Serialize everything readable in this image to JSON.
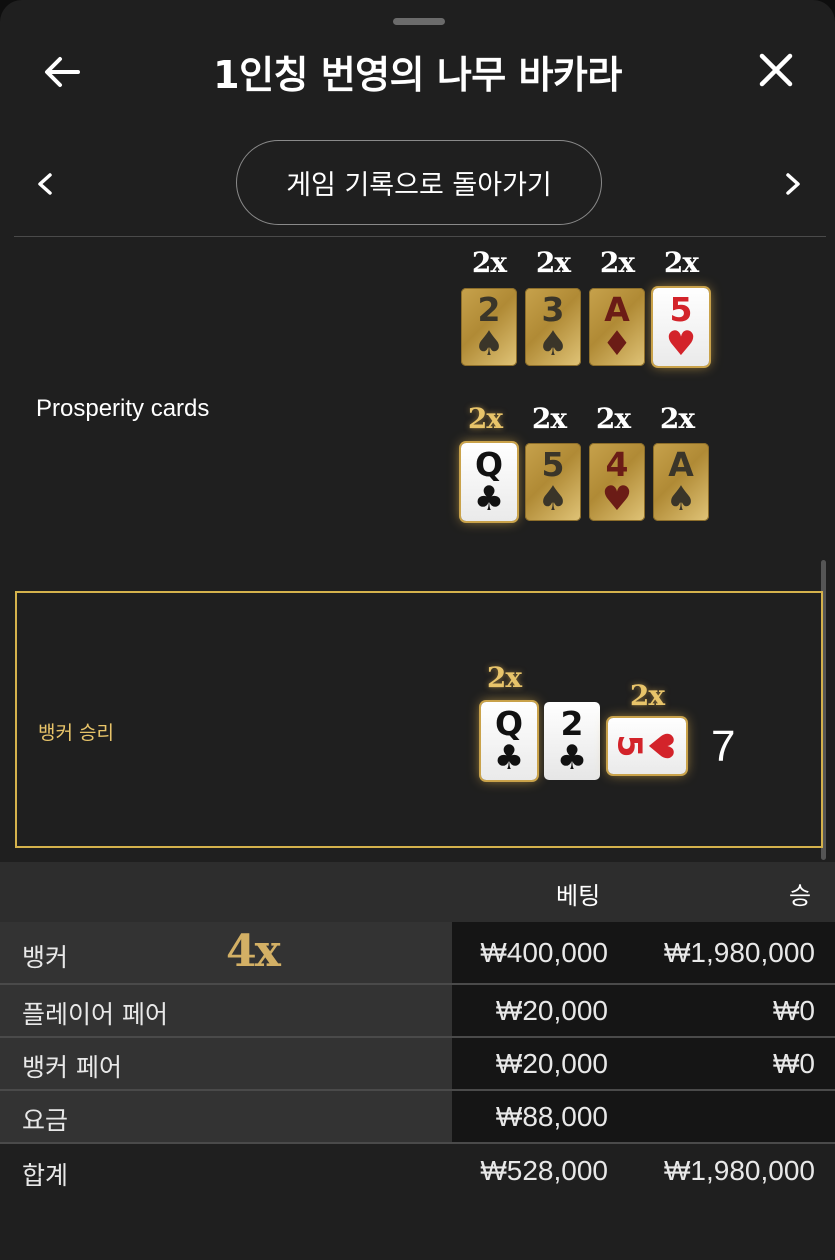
{
  "header": {
    "title": "1인칭 번영의 나무 바카라"
  },
  "nav": {
    "history_label": "게임 기록으로 돌아가기"
  },
  "prosperity": {
    "label": "Prosperity cards",
    "rows": [
      [
        {
          "mult": "2x",
          "rank": "2",
          "suit": "♠",
          "color": "black",
          "highlight": false
        },
        {
          "mult": "2x",
          "rank": "3",
          "suit": "♠",
          "color": "black",
          "highlight": false
        },
        {
          "mult": "2x",
          "rank": "A",
          "suit": "♦",
          "color": "red",
          "highlight": false
        },
        {
          "mult": "2x",
          "rank": "5",
          "suit": "♥",
          "color": "red",
          "highlight": true
        }
      ],
      [
        {
          "mult": "2x",
          "rank": "Q",
          "suit": "♣",
          "color": "black",
          "highlight": true
        },
        {
          "mult": "2x",
          "rank": "5",
          "suit": "♠",
          "color": "black",
          "highlight": false
        },
        {
          "mult": "2x",
          "rank": "4",
          "suit": "♥",
          "color": "red",
          "highlight": false
        },
        {
          "mult": "2x",
          "rank": "A",
          "suit": "♠",
          "color": "black",
          "highlight": false
        }
      ]
    ]
  },
  "result": {
    "label": "뱅커 승리",
    "cards": [
      {
        "mult": "2x",
        "rank": "Q",
        "suit": "♣",
        "color": "black"
      },
      {
        "mult": "",
        "rank": "2",
        "suit": "♣",
        "color": "black"
      },
      {
        "mult": "2x",
        "rank": "5",
        "suit": "♥",
        "color": "red"
      }
    ],
    "score": "7"
  },
  "table": {
    "headers": {
      "bet": "베팅",
      "win": "승"
    },
    "rows": [
      {
        "name": "뱅커",
        "multiplier": "4x",
        "bet": "₩400,000",
        "win": "₩1,980,000"
      },
      {
        "name": "플레이어 페어",
        "bet": "₩20,000",
        "win": "₩0"
      },
      {
        "name": "뱅커 페어",
        "bet": "₩20,000",
        "win": "₩0"
      },
      {
        "name": "요금",
        "bet": "₩88,000",
        "win": ""
      }
    ],
    "total": {
      "name": "합계",
      "bet": "₩528,000",
      "win": "₩1,980,000"
    }
  },
  "colors": {
    "accent_gold": "#d4b24c",
    "background": "#1f1f1f",
    "red_suit": "#d3232a"
  }
}
